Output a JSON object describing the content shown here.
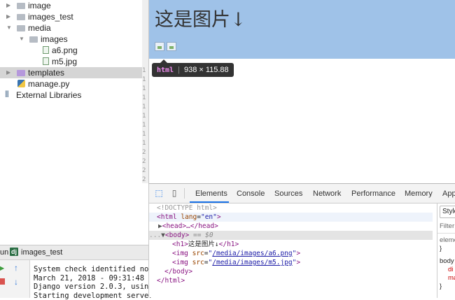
{
  "project_tree": {
    "items": [
      {
        "label": "image",
        "kind": "folder"
      },
      {
        "label": "images_test",
        "kind": "folder"
      },
      {
        "label": "media",
        "kind": "folder"
      },
      {
        "label": "images",
        "kind": "folder"
      },
      {
        "label": "a6.png",
        "kind": "image-file"
      },
      {
        "label": "m5.jpg",
        "kind": "image-file"
      },
      {
        "label": "templates",
        "kind": "folder",
        "selected": true
      },
      {
        "label": "manage.py",
        "kind": "python-file"
      },
      {
        "label": "External Libraries",
        "kind": "libraries"
      }
    ]
  },
  "editor_gutter": {
    "line_numbers": [
      "1",
      "1",
      "1",
      "1",
      "1",
      "1",
      "1",
      "1",
      "1",
      "2",
      "2",
      "2",
      "2",
      "2"
    ]
  },
  "run_panel": {
    "prefix": "un",
    "config_name": "images_test",
    "console_lines": [
      "System check identified no i",
      "March 21, 2018 - 09:31:48",
      "Django version 2.0.3, using",
      "Starting development server"
    ]
  },
  "browser_page": {
    "heading": "这是图片↓",
    "tooltip": {
      "tag": "html",
      "size": "938 × 115.88"
    }
  },
  "devtools": {
    "tabs": [
      "Elements",
      "Console",
      "Sources",
      "Network",
      "Performance",
      "Memory",
      "App"
    ],
    "active_tab": "Elements",
    "dom": {
      "doctype": "<!DOCTYPE html>",
      "html_open": "<html",
      "lang_attr": "lang",
      "lang_val": "\"en\"",
      "close_bracket": ">",
      "head_collapsed": "<head>…</head>",
      "body_open": "<body>",
      "selected_marker": "== $0",
      "h1_open": "<h1>",
      "h1_text": "这是图片↓",
      "h1_close": "</h1>",
      "img_open": "<img",
      "src_attr": "src",
      "img1_src": "/media/images/a6.png",
      "img2_src": "/media/images/m5.jpg",
      "quote": "\"",
      "eq": "=",
      "body_close": "</body>",
      "html_close": "</html>",
      "dots": "..."
    },
    "styles_pane": {
      "tab_label": "Style",
      "filter_label": "Filter",
      "element_label": "eleme",
      "brace_close": "}",
      "body_label": "body",
      "prop1": "di",
      "prop2": "ma"
    }
  },
  "colors": {
    "h1_highlight": "#9fc2e8",
    "tooltip_bg": "#333333",
    "active_tab_underline": "#1a73e8"
  }
}
